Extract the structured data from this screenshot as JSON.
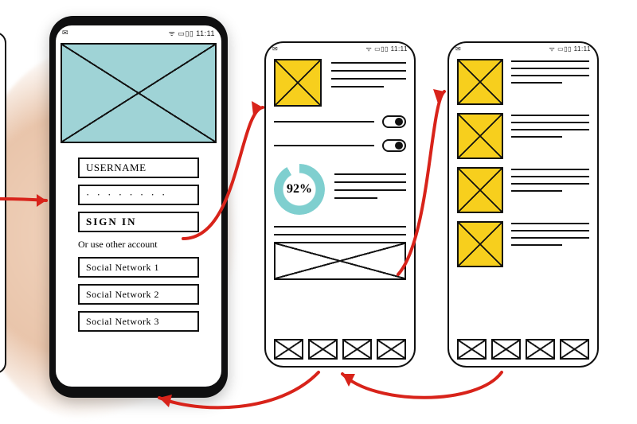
{
  "status": {
    "left_icon": "✉",
    "right": "ᯤ ▭▯▯ 11:11"
  },
  "phone1": {
    "username_label": "USERNAME",
    "password_mask": "· · · · · · · ·",
    "signin_label": "SIGN IN",
    "or_label": "Or use other account",
    "social": [
      "Social Network 1",
      "Social Network 2",
      "Social Network 3"
    ]
  },
  "phone2": {
    "toggles": [
      true,
      true
    ],
    "progress": {
      "pct": 92,
      "display": "92%"
    },
    "nav_count": 4
  },
  "phone3": {
    "list_count": 4,
    "text_line_count": 4,
    "nav_count": 4
  },
  "colors": {
    "accent_teal": "#9fd3d6",
    "accent_yellow": "#f7cf1d",
    "arrow_red": "#d8231a",
    "ink": "#111111"
  }
}
